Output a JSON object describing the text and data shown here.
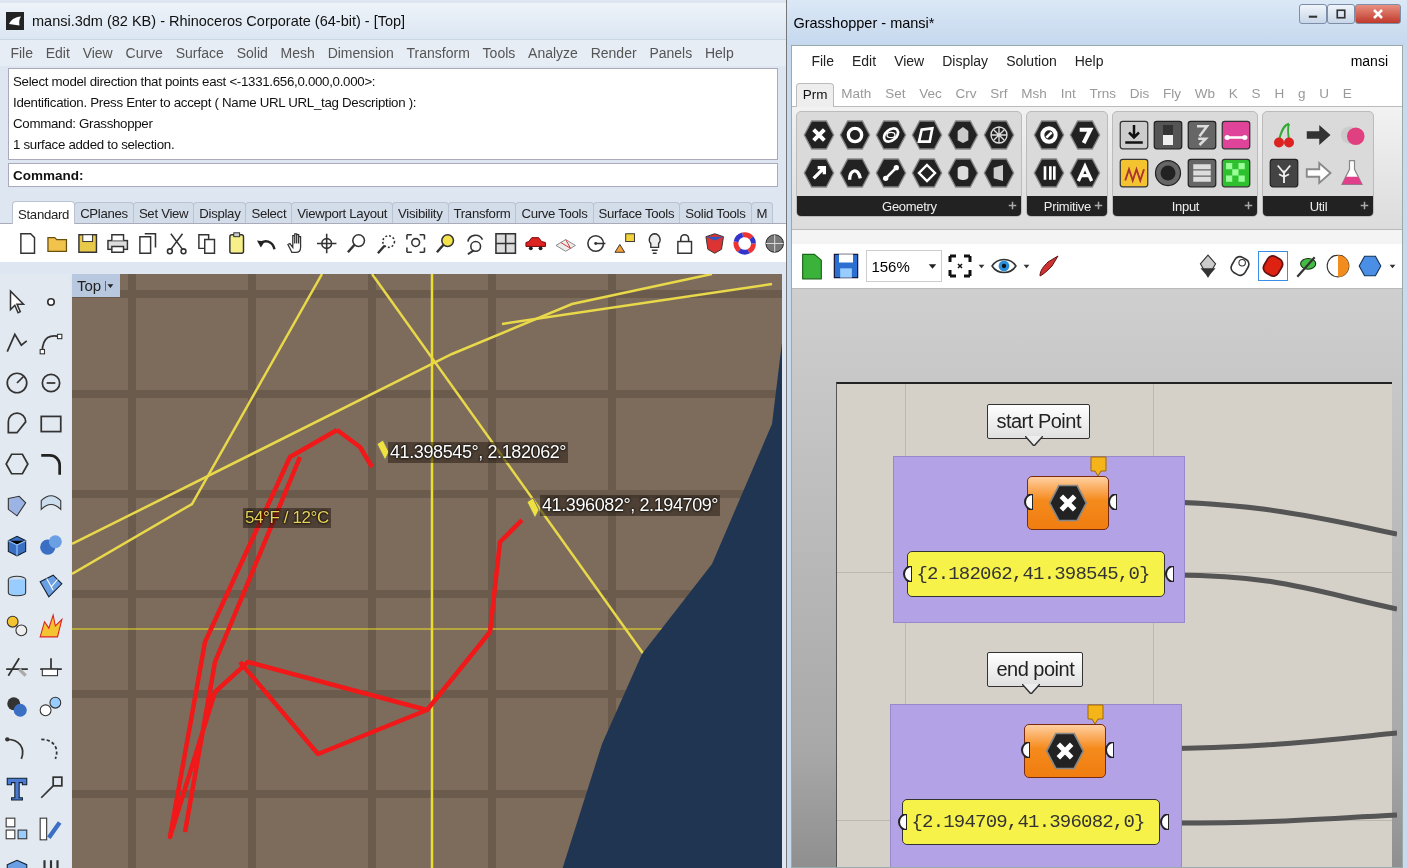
{
  "rhino": {
    "title": "mansi.3dm (82 KB) - Rhinoceros Corporate (64-bit) - [Top]",
    "menu": [
      "File",
      "Edit",
      "View",
      "Curve",
      "Surface",
      "Solid",
      "Mesh",
      "Dimension",
      "Transform",
      "Tools",
      "Analyze",
      "Render",
      "Panels",
      "Help"
    ],
    "command_history": [
      "Select model direction that points east <-1331.656,0.000,0.000>:",
      "Identification. Press Enter to accept ( Name  URL  URL_tag  Description ):",
      "Command: Grasshopper",
      "1 surface added to selection."
    ],
    "command_prompt": "Command:",
    "toolbar_tabs": [
      {
        "label": "Standard",
        "selected": true
      },
      {
        "label": "CPlanes",
        "selected": false
      },
      {
        "label": "Set View",
        "selected": false
      },
      {
        "label": "Display",
        "selected": false
      },
      {
        "label": "Select",
        "selected": false
      },
      {
        "label": "Viewport Layout",
        "selected": false
      },
      {
        "label": "Visibility",
        "selected": false
      },
      {
        "label": "Transform",
        "selected": false
      },
      {
        "label": "Curve Tools",
        "selected": false
      },
      {
        "label": "Surface Tools",
        "selected": false
      },
      {
        "label": "Solid Tools",
        "selected": false
      },
      {
        "label": "M",
        "selected": false
      }
    ],
    "viewport": {
      "label": "Top",
      "map_labels": [
        "41.398545°,  2.182062°",
        "41.396082°,  2.194709°",
        "54°F / 12°C"
      ]
    }
  },
  "grasshopper": {
    "title": "Grasshopper - mansi*",
    "menu": [
      "File",
      "Edit",
      "View",
      "Display",
      "Solution",
      "Help"
    ],
    "document_name": "mansi",
    "tabs": [
      {
        "label": "Prm",
        "selected": true
      },
      {
        "label": "Math",
        "selected": false
      },
      {
        "label": "Set",
        "selected": false
      },
      {
        "label": "Vec",
        "selected": false
      },
      {
        "label": "Crv",
        "selected": false
      },
      {
        "label": "Srf",
        "selected": false
      },
      {
        "label": "Msh",
        "selected": false
      },
      {
        "label": "Int",
        "selected": false
      },
      {
        "label": "Trns",
        "selected": false
      },
      {
        "label": "Dis",
        "selected": false
      },
      {
        "label": "Fly",
        "selected": false
      },
      {
        "label": "Wb",
        "selected": false
      },
      {
        "label": "K",
        "selected": false
      },
      {
        "label": "S",
        "selected": false
      },
      {
        "label": "H",
        "selected": false
      },
      {
        "label": "g",
        "selected": false
      },
      {
        "label": "U",
        "selected": false
      },
      {
        "label": "E",
        "selected": false
      }
    ],
    "panels": [
      "Geometry",
      "Primitive",
      "Input",
      "Util"
    ],
    "zoom": "156%",
    "groups": [
      {
        "label": "start Point",
        "value": "{2.182062,41.398545,0}"
      },
      {
        "label": "end point",
        "value": "{2.194709,41.396082,0}"
      }
    ]
  }
}
